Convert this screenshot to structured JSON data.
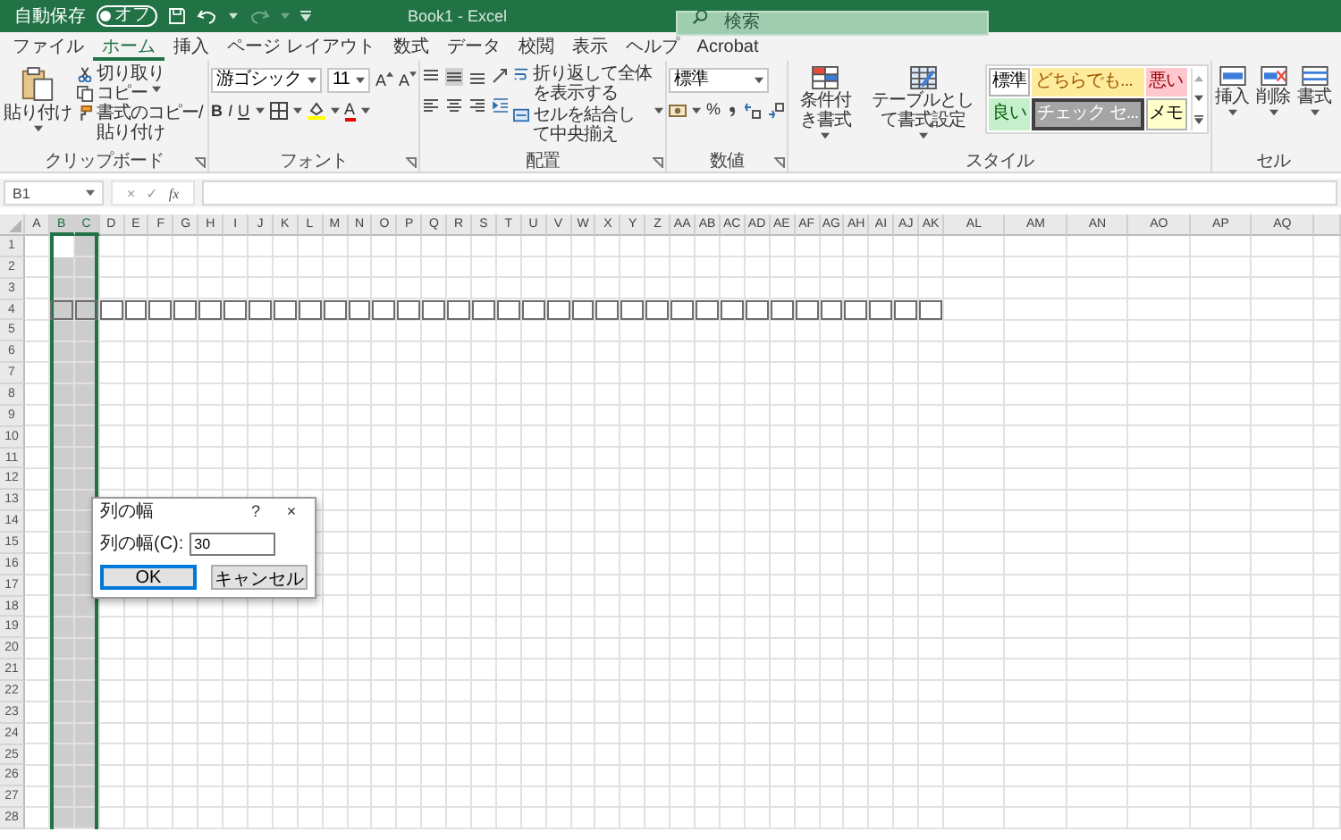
{
  "title_bar": {
    "autosave_label": "自動保存",
    "autosave_state": "オフ",
    "autosave_on": false,
    "title": "Book1 - Excel",
    "search_placeholder": "検索"
  },
  "tabs": [
    {
      "label": "ファイル",
      "selected": false
    },
    {
      "label": "ホーム",
      "selected": true
    },
    {
      "label": "挿入",
      "selected": false
    },
    {
      "label": "ページ レイアウト",
      "selected": false
    },
    {
      "label": "数式",
      "selected": false
    },
    {
      "label": "データ",
      "selected": false
    },
    {
      "label": "校閲",
      "selected": false
    },
    {
      "label": "表示",
      "selected": false
    },
    {
      "label": "ヘルプ",
      "selected": false
    },
    {
      "label": "Acrobat",
      "selected": false
    }
  ],
  "ribbon": {
    "clipboard": {
      "paste": "貼り付け",
      "cut": "切り取り",
      "copy": "コピー",
      "format_painter": "書式のコピー/貼り付け",
      "label": "クリップボード"
    },
    "font": {
      "name": "游ゴシック",
      "size": "11",
      "grow": "A",
      "shrink": "A",
      "bold": "B",
      "italic": "I",
      "underline": "U",
      "font_color": "A",
      "label": "フォント"
    },
    "alignment": {
      "wrap": "折り返して全体を表示する",
      "merge": "セルを結合して中央揃え",
      "label": "配置"
    },
    "number": {
      "format": "標準",
      "percent": "%",
      "label": "数値"
    },
    "styles": {
      "conditional": "条件付き書式",
      "table": "テーブルとして書式設定",
      "label": "スタイル",
      "gallery": [
        {
          "label": "標準",
          "kind": "normal"
        },
        {
          "label": "どちらでも...",
          "kind": "neutral"
        },
        {
          "label": "悪い",
          "kind": "bad"
        },
        {
          "label": "良い",
          "kind": "good"
        },
        {
          "label": "チェック セ...",
          "kind": "check"
        },
        {
          "label": "メモ",
          "kind": "note"
        }
      ]
    },
    "cells": {
      "insert": "挿入",
      "delete": "削除",
      "format": "書式",
      "label": "セル"
    }
  },
  "formula_bar": {
    "name_box": "B1",
    "cancel": "×",
    "enter": "✓",
    "function": "fx"
  },
  "sheet": {
    "columns": [
      {
        "label": "A",
        "kind": "narrow",
        "selected": false,
        "bordered": false
      },
      {
        "label": "B",
        "kind": "narrow",
        "selected": true,
        "bordered": true
      },
      {
        "label": "C",
        "kind": "narrow",
        "selected": true,
        "bordered": true
      },
      {
        "label": "D",
        "kind": "narrow",
        "selected": false,
        "bordered": true
      },
      {
        "label": "E",
        "kind": "narrow",
        "selected": false,
        "bordered": true
      },
      {
        "label": "F",
        "kind": "narrow",
        "selected": false,
        "bordered": true
      },
      {
        "label": "G",
        "kind": "narrow",
        "selected": false,
        "bordered": true
      },
      {
        "label": "H",
        "kind": "narrow",
        "selected": false,
        "bordered": true
      },
      {
        "label": "I",
        "kind": "narrow",
        "selected": false,
        "bordered": true
      },
      {
        "label": "J",
        "kind": "narrow",
        "selected": false,
        "bordered": true
      },
      {
        "label": "K",
        "kind": "narrow",
        "selected": false,
        "bordered": true
      },
      {
        "label": "L",
        "kind": "narrow",
        "selected": false,
        "bordered": true
      },
      {
        "label": "M",
        "kind": "narrow",
        "selected": false,
        "bordered": true
      },
      {
        "label": "N",
        "kind": "narrow",
        "selected": false,
        "bordered": true
      },
      {
        "label": "O",
        "kind": "narrow",
        "selected": false,
        "bordered": true
      },
      {
        "label": "P",
        "kind": "narrow",
        "selected": false,
        "bordered": true
      },
      {
        "label": "Q",
        "kind": "narrow",
        "selected": false,
        "bordered": true
      },
      {
        "label": "R",
        "kind": "narrow",
        "selected": false,
        "bordered": true
      },
      {
        "label": "S",
        "kind": "narrow",
        "selected": false,
        "bordered": true
      },
      {
        "label": "T",
        "kind": "narrow",
        "selected": false,
        "bordered": true
      },
      {
        "label": "U",
        "kind": "narrow",
        "selected": false,
        "bordered": true
      },
      {
        "label": "V",
        "kind": "narrow",
        "selected": false,
        "bordered": true
      },
      {
        "label": "W",
        "kind": "narrow",
        "selected": false,
        "bordered": true
      },
      {
        "label": "X",
        "kind": "narrow",
        "selected": false,
        "bordered": true
      },
      {
        "label": "Y",
        "kind": "narrow",
        "selected": false,
        "bordered": true
      },
      {
        "label": "Z",
        "kind": "narrow",
        "selected": false,
        "bordered": true
      },
      {
        "label": "AA",
        "kind": "narrow",
        "selected": false,
        "bordered": true
      },
      {
        "label": "AB",
        "kind": "narrow",
        "selected": false,
        "bordered": true
      },
      {
        "label": "AC",
        "kind": "narrow",
        "selected": false,
        "bordered": true
      },
      {
        "label": "AD",
        "kind": "narrow",
        "selected": false,
        "bordered": true
      },
      {
        "label": "AE",
        "kind": "narrow",
        "selected": false,
        "bordered": true
      },
      {
        "label": "AF",
        "kind": "narrow",
        "selected": false,
        "bordered": true
      },
      {
        "label": "AG",
        "kind": "narrow",
        "selected": false,
        "bordered": true
      },
      {
        "label": "AH",
        "kind": "narrow",
        "selected": false,
        "bordered": true
      },
      {
        "label": "AI",
        "kind": "narrow",
        "selected": false,
        "bordered": true
      },
      {
        "label": "AJ",
        "kind": "narrow",
        "selected": false,
        "bordered": true
      },
      {
        "label": "AK",
        "kind": "narrow",
        "selected": false,
        "bordered": true
      },
      {
        "label": "AL",
        "kind": "wide",
        "selected": false,
        "bordered": false
      },
      {
        "label": "AM",
        "kind": "wide",
        "selected": false,
        "bordered": false
      },
      {
        "label": "AN",
        "kind": "wide",
        "selected": false,
        "bordered": false
      },
      {
        "label": "AO",
        "kind": "wide",
        "selected": false,
        "bordered": false
      },
      {
        "label": "AP",
        "kind": "wide",
        "selected": false,
        "bordered": false
      },
      {
        "label": "AQ",
        "kind": "wide",
        "selected": false,
        "bordered": false
      }
    ],
    "rows": [
      {
        "label": "1",
        "bordered": false
      },
      {
        "label": "2",
        "bordered": false
      },
      {
        "label": "3",
        "bordered": false
      },
      {
        "label": "4",
        "bordered": true
      },
      {
        "label": "5",
        "bordered": false
      },
      {
        "label": "6",
        "bordered": false
      },
      {
        "label": "7",
        "bordered": false
      },
      {
        "label": "8",
        "bordered": false
      },
      {
        "label": "9",
        "bordered": false
      },
      {
        "label": "10",
        "bordered": false
      },
      {
        "label": "11",
        "bordered": false
      },
      {
        "label": "12",
        "bordered": false
      },
      {
        "label": "13",
        "bordered": false
      },
      {
        "label": "14",
        "bordered": false
      },
      {
        "label": "15",
        "bordered": false
      },
      {
        "label": "16",
        "bordered": false
      },
      {
        "label": "17",
        "bordered": false
      },
      {
        "label": "18",
        "bordered": false
      },
      {
        "label": "19",
        "bordered": false
      },
      {
        "label": "20",
        "bordered": false
      },
      {
        "label": "21",
        "bordered": false
      },
      {
        "label": "22",
        "bordered": false
      },
      {
        "label": "23",
        "bordered": false
      },
      {
        "label": "24",
        "bordered": false
      },
      {
        "label": "25",
        "bordered": false
      },
      {
        "label": "26",
        "bordered": false
      },
      {
        "label": "27",
        "bordered": false
      },
      {
        "label": "28",
        "bordered": false
      }
    ]
  },
  "dialog": {
    "title": "列の幅",
    "help": "?",
    "close": "×",
    "field_label": "列の幅(C):",
    "value": "30",
    "ok": "OK",
    "ok_focused": true,
    "cancel": "キャンセル"
  }
}
